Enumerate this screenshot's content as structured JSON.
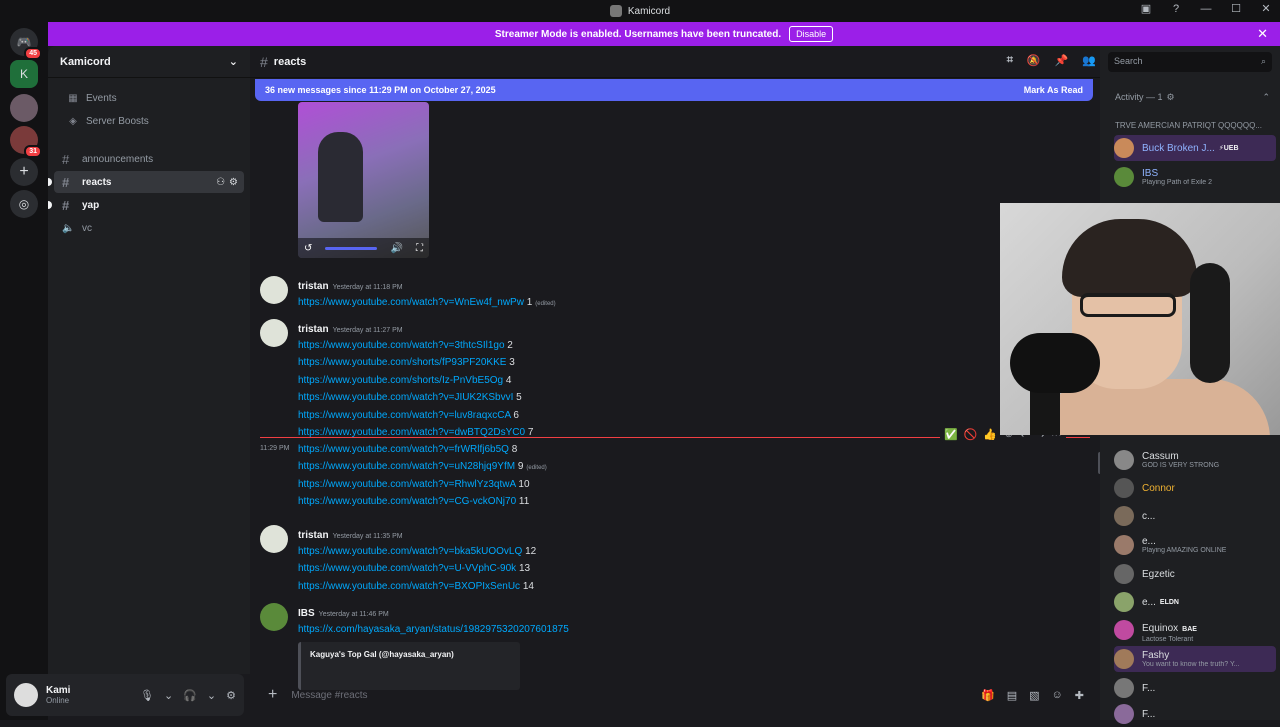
{
  "window": {
    "title": "Kamicord"
  },
  "banner": {
    "text": "Streamer Mode is enabled. Usernames have been truncated.",
    "button": "Disable",
    "close": "✕"
  },
  "guilds": {
    "badge1": "45",
    "badge2": "31"
  },
  "server": {
    "name": "Kamicord",
    "chevron": "⌄"
  },
  "sidebar": {
    "events": "Events",
    "boosts": "Server Boosts",
    "channels": [
      {
        "name": "announcements",
        "type": "text"
      },
      {
        "name": "reacts",
        "type": "text",
        "active": true
      },
      {
        "name": "yap",
        "type": "text"
      },
      {
        "name": "vc",
        "type": "voice"
      }
    ]
  },
  "user": {
    "name": "Kami",
    "status": "Online"
  },
  "chat": {
    "channel": "reacts",
    "new_messages": "36 new messages since 11:29 PM on October 27, 2025",
    "mark_read": "Mark As Read",
    "composer_placeholder": "Message #reacts",
    "groups": [
      {
        "author": "tristan",
        "time": "Yesterday at 11:18 PM",
        "lines": [
          {
            "url": "https://www.youtube.com/watch?v=WnEw4f_nwPw",
            "num": "1",
            "edited": "(edited)"
          }
        ]
      },
      {
        "author": "tristan",
        "time": "Yesterday at 11:27 PM",
        "lines": [
          {
            "url": "https://www.youtube.com/watch?v=3thtcSIl1go",
            "num": "2"
          },
          {
            "url": "https://www.youtube.com/shorts/fP93PF20KKE",
            "num": "3"
          },
          {
            "url": "https://www.youtube.com/shorts/Iz-PnVbE5Og",
            "num": "4"
          },
          {
            "url": "https://www.youtube.com/watch?v=JIUK2KSbvvI",
            "num": "5"
          },
          {
            "url": "https://www.youtube.com/watch?v=luv8raqxcCA",
            "num": "6"
          },
          {
            "url": "https://www.youtube.com/watch?v=dwBTQ2DsYC0",
            "num": "7"
          }
        ]
      },
      {
        "side_time": "11:29 PM",
        "lines": [
          {
            "url": "https://www.youtube.com/watch?v=frWRlfj6b5Q",
            "num": "8"
          },
          {
            "url": "https://www.youtube.com/watch?v=uN28hjq9YfM",
            "num": "9",
            "edited": "(edited)"
          },
          {
            "url": "https://www.youtube.com/watch?v=RhwlYz3qtwA",
            "num": "10"
          },
          {
            "url": "https://www.youtube.com/watch?v=CG-vckONj70",
            "num": "11"
          }
        ]
      },
      {
        "author": "tristan",
        "time": "Yesterday at 11:35 PM",
        "lines": [
          {
            "url": "https://www.youtube.com/watch?v=bka5kUOOvLQ",
            "num": "12"
          },
          {
            "url": "https://www.youtube.com/watch?v=U-VVphC-90k",
            "num": "13"
          },
          {
            "url": "https://www.youtube.com/watch?v=BXOPIxSenUc",
            "num": "14"
          }
        ]
      },
      {
        "author": "IBS",
        "time": "Yesterday at 11:46 PM",
        "lines": [
          {
            "url": "https://x.com/hayasaka_aryan/status/1982975320207601875",
            "num": ""
          }
        ],
        "embed": "Kaguya's Top Gal (@hayasaka_aryan)"
      }
    ]
  },
  "right": {
    "search_placeholder": "Search",
    "activity": "Activity — 1",
    "truncated": "TRVE AMERCIAN PATRIQT QQQQQQ...",
    "members_top": [
      {
        "name": "Buck Broken J...",
        "tag": "⚡UEB",
        "sub": ""
      },
      {
        "name": "IBS",
        "tag": "",
        "sub": "Playing Path of Exile 2"
      }
    ],
    "members": [
      {
        "name": "Cassum",
        "tag": "",
        "sub": "GOD IS VERY STRONG"
      },
      {
        "name": "Connor",
        "tag": "",
        "sub": ""
      },
      {
        "name": "c...",
        "tag": "",
        "sub": ""
      },
      {
        "name": "e...",
        "tag": "",
        "sub": "Playing AMAZING ONLINE"
      },
      {
        "name": "Egzetic",
        "tag": "",
        "sub": ""
      },
      {
        "name": "e...",
        "tag": "ELDN",
        "sub": ""
      },
      {
        "name": "Equinox",
        "tag": "BAE",
        "sub": "Lactose Tolerant"
      },
      {
        "name": "Fashy",
        "tag": "",
        "sub": "You want to know the truth? Y..."
      },
      {
        "name": "F...",
        "tag": "",
        "sub": ""
      },
      {
        "name": "F...",
        "tag": "",
        "sub": ""
      }
    ]
  },
  "colors": {
    "accent": "#5865f2",
    "banner": "#9b1fe8",
    "link": "#00a8fc",
    "divider": "#f23f43"
  }
}
